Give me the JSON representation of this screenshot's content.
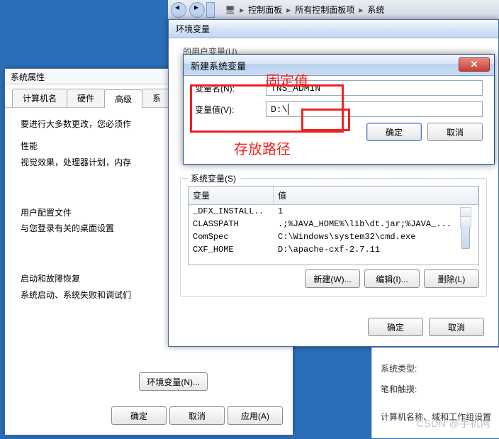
{
  "breadcrumb": {
    "a": "控制面板",
    "b": "所有控制面板项",
    "c": "系统"
  },
  "sysprops": {
    "title": "系统属性",
    "tabs": [
      "计算机名",
      "硬件",
      "高级",
      "系"
    ],
    "hint": "要进行大多数更改，您必须作",
    "perf_title": "性能",
    "perf_text": "视觉效果，处理器计划，内存",
    "prof_title": "用户配置文件",
    "prof_text": "与您登录有关的桌面设置",
    "boot_title": "启动和故障恢复",
    "boot_text": "系统启动、系统失败和调试们",
    "env_btn": "环境变量(N)...",
    "ok": "确定",
    "cancel": "取消",
    "apply": "应用(A)"
  },
  "envdlg": {
    "title": "环境变量",
    "user_hint": "的用户变量(U)",
    "sys_title": "系统变量(S)",
    "col1": "变量",
    "col2": "值",
    "rows": [
      {
        "n": "_DFX_INSTALL..",
        "v": "1"
      },
      {
        "n": "CLASSPATH",
        "v": ".;%JAVA_HOME%\\lib\\dt.jar;%JAVA_..."
      },
      {
        "n": "ComSpec",
        "v": "C:\\Windows\\system32\\cmd.exe"
      },
      {
        "n": "CXF_HOME",
        "v": "D:\\apache-cxf-2.7.11"
      }
    ],
    "new": "新建(W)...",
    "edit": "编辑(I)...",
    "del": "删除(L)",
    "ok": "确定",
    "cancel": "取消"
  },
  "newvar": {
    "title": "新建系统变量",
    "name_label": "变量名(N):",
    "name_value": "TNS_ADMIN",
    "val_label": "变量值(V):",
    "val_value": "D:\\",
    "ok": "确定",
    "cancel": "取消"
  },
  "anno": {
    "fixed": "固定值",
    "path": "存放路径"
  },
  "right": {
    "l1": "系统类型:",
    "l2": "笔和触摸:",
    "l3": "计算机名称、域和工作组设置"
  },
  "watermark": "CSDN @手机网"
}
